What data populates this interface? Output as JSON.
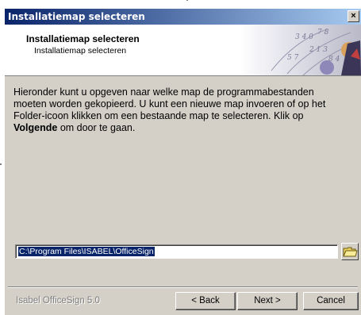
{
  "window": {
    "title": "Installatiemap selecteren",
    "close_glyph": "×"
  },
  "header": {
    "title": "Installatiemap selecteren",
    "subtitle": "Installatiemap selecteren"
  },
  "body": {
    "line1": "Hieronder kunt u opgeven naar welke map de programmabestanden",
    "line2": "moeten worden gekopieerd. U kunt een nieuwe map invoeren of op het",
    "line3": "Folder-icoon klikken om een bestaande map te selecteren. Klik op",
    "bold_word": "Volgende",
    "line4_rest": " om door te gaan."
  },
  "path": {
    "value": "C:\\Program Files\\ISABEL\\OfficeSign"
  },
  "footer": {
    "brand": "Isabel OfficeSign 5.0",
    "back_label": "< Back",
    "next_label": "Next >",
    "cancel_label": "Cancel"
  },
  "icons": {
    "folder": "folder-icon",
    "close": "close-icon"
  }
}
